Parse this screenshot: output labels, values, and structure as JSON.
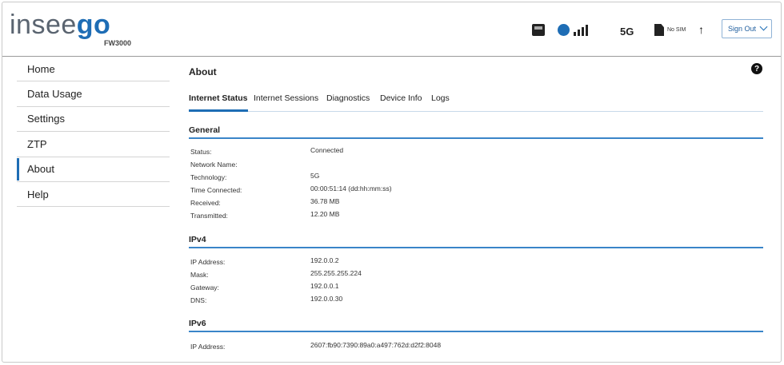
{
  "brand": {
    "logo_part1": "insee",
    "logo_part2": "go",
    "model": "FW3000"
  },
  "status_bar": {
    "icons": [
      "router-icon",
      "signal-strength-icon",
      "sim-icon",
      "upload-arrow-icon"
    ],
    "network": "5G",
    "sim": "No SIM",
    "signal_bars": 4
  },
  "header": {
    "signout_label": "Sign Out"
  },
  "sidebar": {
    "items": [
      {
        "label": "Home"
      },
      {
        "label": "Data Usage"
      },
      {
        "label": "Settings"
      },
      {
        "label": "ZTP"
      },
      {
        "label": "About",
        "active": true
      },
      {
        "label": "Help"
      }
    ]
  },
  "main": {
    "title": "About",
    "help_glyph": "?",
    "tabs": [
      {
        "label": "Internet Status",
        "active": true
      },
      {
        "label": "Internet Sessions"
      },
      {
        "label": "Diagnostics"
      },
      {
        "label": "Device Info"
      },
      {
        "label": "Logs"
      }
    ],
    "general": {
      "heading": "General",
      "rows": [
        {
          "label": "Status:",
          "value": "Connected"
        },
        {
          "label": "Network Name:",
          "value": ""
        },
        {
          "label": "Technology:",
          "value": "5G"
        },
        {
          "label": "Time Connected:",
          "value": "00:00:51:14 (dd:hh:mm:ss)"
        },
        {
          "label": "Received:",
          "value": "36.78 MB"
        },
        {
          "label": "Transmitted:",
          "value": "12.20 MB"
        }
      ]
    },
    "ipv4": {
      "heading": "IPv4",
      "rows": [
        {
          "label": "IP Address:",
          "value": "192.0.0.2"
        },
        {
          "label": "Mask:",
          "value": "255.255.255.224"
        },
        {
          "label": "Gateway:",
          "value": "192.0.0.1"
        },
        {
          "label": "DNS:",
          "value": "192.0.0.30"
        }
      ]
    },
    "ipv6": {
      "heading": "IPv6",
      "rows": [
        {
          "label": "IP Address:",
          "value": "2607:fb90:7390:89a0:a497:762d:d2f2:8048"
        }
      ]
    }
  },
  "colors": {
    "accent": "#1e6db5",
    "logo_gray": "#5a6470"
  }
}
